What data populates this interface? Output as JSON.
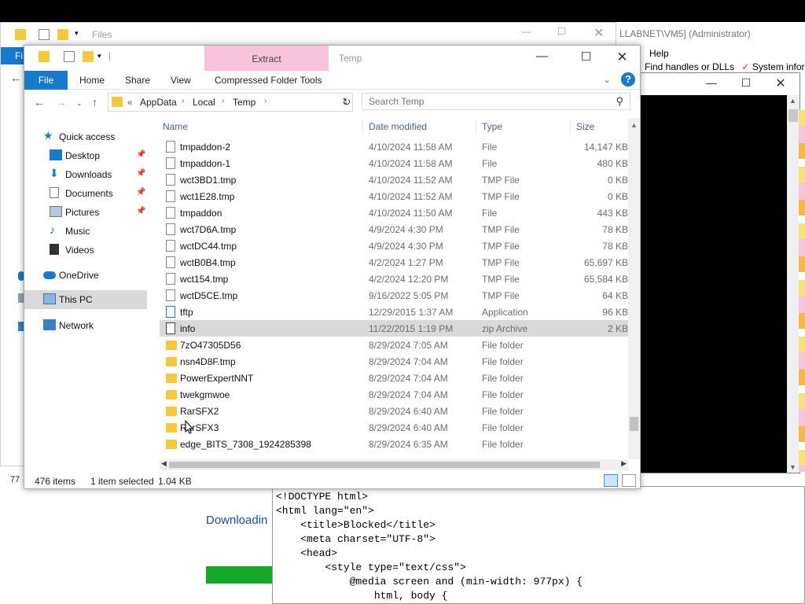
{
  "back_window": {
    "title": "Files",
    "file_tab": "Fi",
    "status_count": "77"
  },
  "admin_window": {
    "title": "LLABNET\\VM5] (Administrator)",
    "menu_help": "Help",
    "toolbar_text": "Find handles or DLLs",
    "toolbar_text2": "System infor"
  },
  "explorer": {
    "title": "Temp",
    "context_tab": "Extract",
    "ribbon": {
      "file": "File",
      "home": "Home",
      "share": "Share",
      "view": "View",
      "context": "Compressed Folder Tools"
    },
    "address": {
      "overflow": "«",
      "segments": [
        "AppData",
        "Local",
        "Temp"
      ]
    },
    "search": {
      "placeholder": "Search Temp"
    },
    "nav": [
      {
        "label": "Quick access",
        "icon": "star-icon",
        "pinned": false
      },
      {
        "label": "Desktop",
        "icon": "desktop-icon",
        "pinned": true
      },
      {
        "label": "Downloads",
        "icon": "download-icon",
        "pinned": true
      },
      {
        "label": "Documents",
        "icon": "documents-icon",
        "pinned": true
      },
      {
        "label": "Pictures",
        "icon": "pictures-icon",
        "pinned": true
      },
      {
        "label": "Music",
        "icon": "music-icon",
        "pinned": false
      },
      {
        "label": "Videos",
        "icon": "videos-icon",
        "pinned": false
      },
      {
        "label": "OneDrive",
        "icon": "cloud-icon",
        "pinned": false
      },
      {
        "label": "This PC",
        "icon": "computer-icon",
        "pinned": false
      },
      {
        "label": "Network",
        "icon": "network-icon",
        "pinned": false
      }
    ],
    "columns": {
      "name": "Name",
      "date": "Date modified",
      "type": "Type",
      "size": "Size"
    },
    "files": [
      {
        "name": "tmpaddon-2",
        "date": "4/10/2024 11:58 AM",
        "type": "File",
        "size": "14,147 KB",
        "icon": "file"
      },
      {
        "name": "tmpaddon-1",
        "date": "4/10/2024 11:58 AM",
        "type": "File",
        "size": "480 KB",
        "icon": "file"
      },
      {
        "name": "wct3BD1.tmp",
        "date": "4/10/2024 11:52 AM",
        "type": "TMP File",
        "size": "0 KB",
        "icon": "file"
      },
      {
        "name": "wct1E28.tmp",
        "date": "4/10/2024 11:52 AM",
        "type": "TMP File",
        "size": "0 KB",
        "icon": "file"
      },
      {
        "name": "tmpaddon",
        "date": "4/10/2024 11:50 AM",
        "type": "File",
        "size": "443 KB",
        "icon": "file"
      },
      {
        "name": "wct7D6A.tmp",
        "date": "4/9/2024 4:30 PM",
        "type": "TMP File",
        "size": "78 KB",
        "icon": "file"
      },
      {
        "name": "wctDC44.tmp",
        "date": "4/9/2024 4:30 PM",
        "type": "TMP File",
        "size": "78 KB",
        "icon": "file"
      },
      {
        "name": "wctB0B4.tmp",
        "date": "4/2/2024 1:27 PM",
        "type": "TMP File",
        "size": "65,697 KB",
        "icon": "file"
      },
      {
        "name": "wct154.tmp",
        "date": "4/2/2024 12:20 PM",
        "type": "TMP File",
        "size": "65,584 KB",
        "icon": "file"
      },
      {
        "name": "wctD5CE.tmp",
        "date": "9/16/2022 5:05 PM",
        "type": "TMP File",
        "size": "64 KB",
        "icon": "file"
      },
      {
        "name": "tftp",
        "date": "12/29/2015 1:37 AM",
        "type": "Application",
        "size": "96 KB",
        "icon": "app"
      },
      {
        "name": "info",
        "date": "11/22/2015 1:19 PM",
        "type": "zip Archive",
        "size": "2 KB",
        "icon": "zip",
        "selected": true
      },
      {
        "name": "7zO47305D56",
        "date": "8/29/2024 7:05 AM",
        "type": "File folder",
        "size": "",
        "icon": "folder"
      },
      {
        "name": "nsn4D8F.tmp",
        "date": "8/29/2024 7:04 AM",
        "type": "File folder",
        "size": "",
        "icon": "folder"
      },
      {
        "name": "PowerExpertNNT",
        "date": "8/29/2024 7:04 AM",
        "type": "File folder",
        "size": "",
        "icon": "folder"
      },
      {
        "name": "twekgmwoe",
        "date": "8/29/2024 7:04 AM",
        "type": "File folder",
        "size": "",
        "icon": "folder"
      },
      {
        "name": "RarSFX2",
        "date": "8/29/2024 6:40 AM",
        "type": "File folder",
        "size": "",
        "icon": "folder"
      },
      {
        "name": "RarSFX3",
        "date": "8/29/2024 6:40 AM",
        "type": "File folder",
        "size": "",
        "icon": "folder"
      },
      {
        "name": "edge_BITS_7308_1924285398",
        "date": "8/29/2024 6:35 AM",
        "type": "File folder",
        "size": "",
        "icon": "folder"
      }
    ],
    "status": {
      "count": "476 items",
      "selected": "1 item selected",
      "size": "1.04 KB"
    }
  },
  "browser_page": {
    "downloading": "Downloadin",
    "code_lines": [
      "<!DOCTYPE html>",
      "<html lang=\"en\">",
      "    <title>Blocked</title>",
      "    <meta charset=\"UTF-8\">",
      "    <head>",
      "        <style type=\"text/css\">",
      "            @media screen and (min-width: 977px) {",
      "                html, body {"
    ]
  }
}
